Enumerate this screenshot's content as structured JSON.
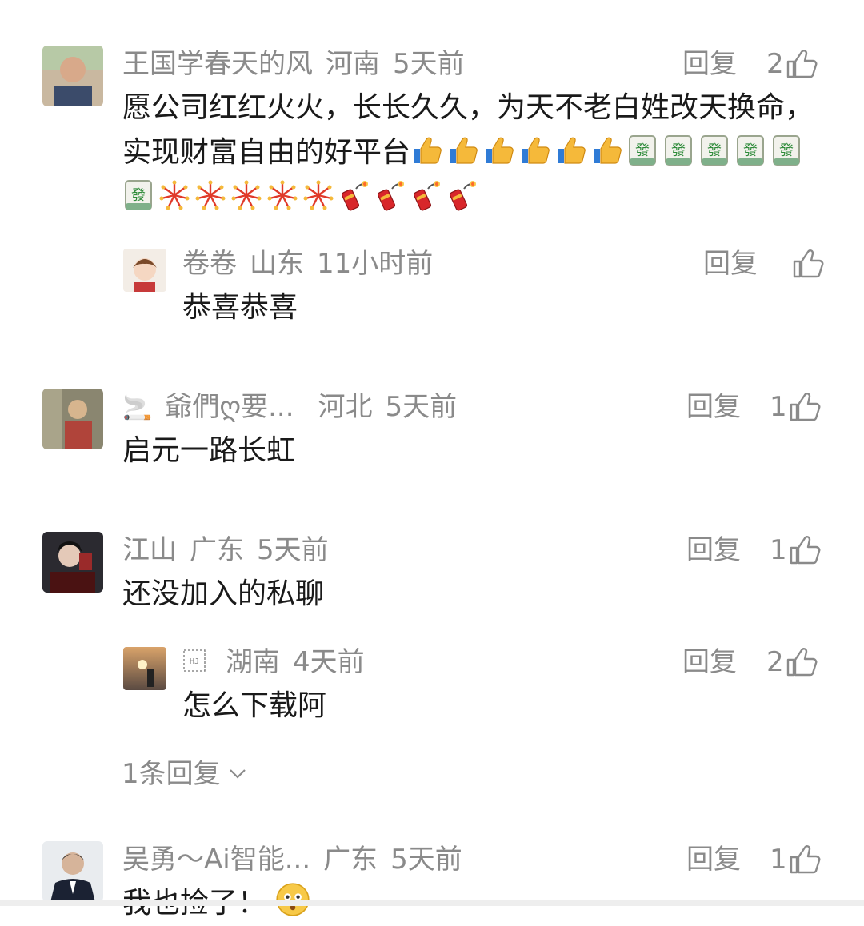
{
  "comments": [
    {
      "name": "王国学春天的风",
      "region": "河南",
      "time": "5天前",
      "reply_label": "回复",
      "likes": "2",
      "text": "愿公司红红火火，长长久久，为天不老白姓改天换命，实现财富自由的好平台",
      "emoji_sequence": [
        "thumbs-up",
        "thumbs-up",
        "thumbs-up",
        "thumbs-up",
        "thumbs-up",
        "thumbs-up",
        "fa-tile",
        "fa-tile",
        "fa-tile",
        "fa-tile",
        "fa-tile",
        "fa-tile",
        "fireworks",
        "fireworks",
        "fireworks",
        "fireworks",
        "fireworks",
        "firecracker",
        "firecracker",
        "firecracker",
        "firecracker"
      ],
      "reply": {
        "name": "卷卷",
        "region": "山东",
        "time": "11小时前",
        "reply_label": "回复",
        "text": "恭喜恭喜"
      }
    },
    {
      "name": "爺們ღ要...",
      "region": "河北",
      "time": "5天前",
      "reply_label": "回复",
      "likes": "1",
      "text": "启元一路长虹"
    },
    {
      "name": "江山",
      "region": "广东",
      "time": "5天前",
      "reply_label": "回复",
      "likes": "1",
      "text": "还没加入的私聊",
      "reply": {
        "name": "",
        "region": "湖南",
        "time": "4天前",
        "reply_label": "回复",
        "likes": "2",
        "text": "怎么下载阿"
      },
      "more_replies": "1条回复"
    },
    {
      "name": "吴勇～Ai智能...",
      "region": "广东",
      "time": "5天前",
      "reply_label": "回复",
      "likes": "1",
      "text": "我也捡了！"
    }
  ],
  "colors": {
    "meta_gray": "#8a8a8a",
    "text_dark": "#1a1a1a",
    "divider": "#eeeeee"
  }
}
